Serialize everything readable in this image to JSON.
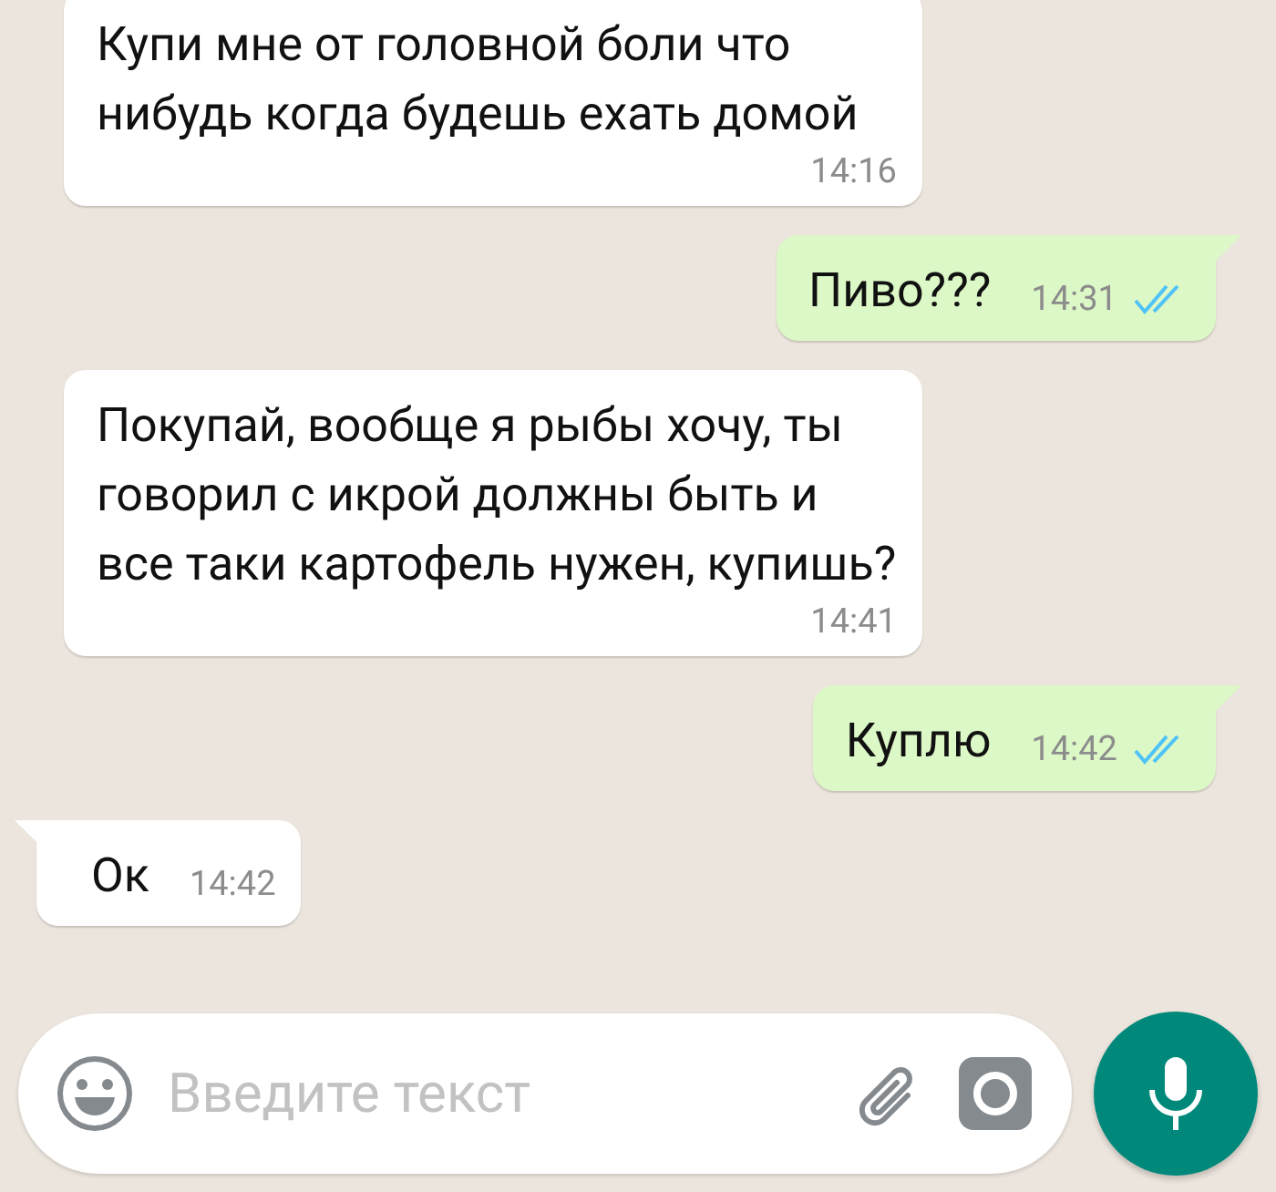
{
  "messages": [
    {
      "kind": "incoming",
      "tail": false,
      "text": "Купи мне от головной боли что нибудь когда будешь ехать домой",
      "time": "14:16"
    },
    {
      "kind": "outgoing",
      "tail": true,
      "text": "Пиво???",
      "time": "14:31",
      "read": true
    },
    {
      "kind": "incoming",
      "tail": false,
      "text": "Покупай, вообще я рыбы хочу, ты говорил с икрой должны быть и все таки картофель нужен, купишь?",
      "time": "14:41"
    },
    {
      "kind": "outgoing",
      "tail": true,
      "text": "Куплю",
      "time": "14:42",
      "read": true
    },
    {
      "kind": "incoming",
      "tail": true,
      "text": "Ок",
      "time": "14:42"
    }
  ],
  "composer": {
    "placeholder": "Введите текст"
  }
}
